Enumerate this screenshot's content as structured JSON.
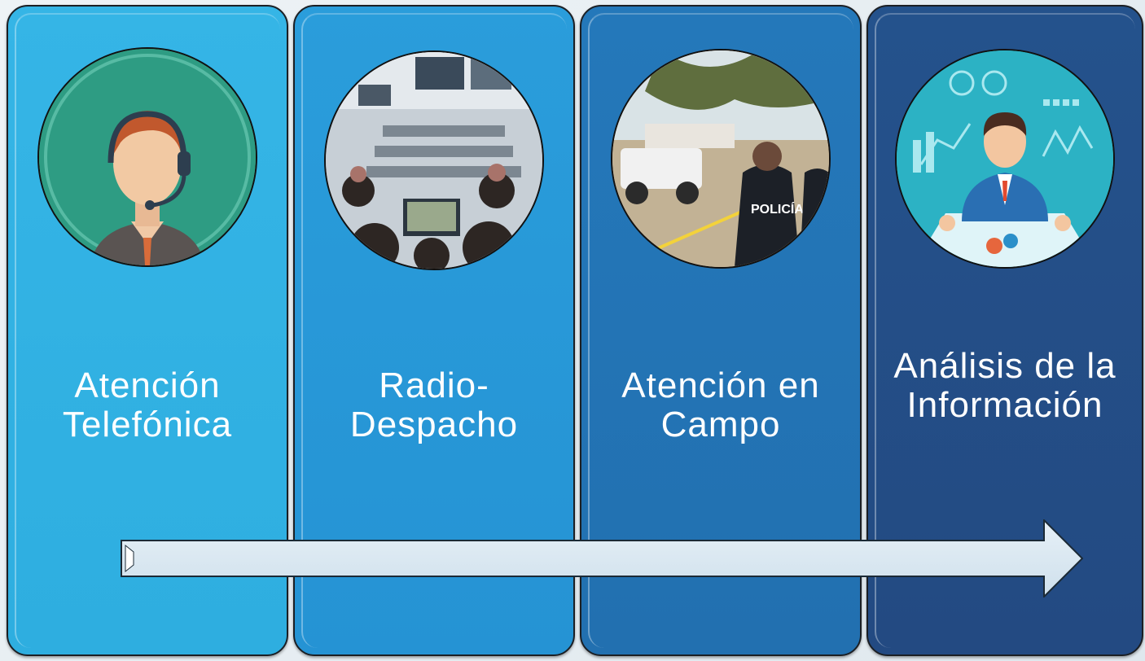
{
  "panels": [
    {
      "label": "Atención Telefónica",
      "color": "#2fb0e2",
      "icon": "call-center-operator-icon"
    },
    {
      "label": "Radio-Despacho",
      "color": "#2795d5",
      "icon": "dispatch-room-photo"
    },
    {
      "label": "Atención en Campo",
      "color": "#2373b3",
      "icon": "municipal-police-photo"
    },
    {
      "label": "Análisis  de la Información",
      "color": "#234f88",
      "icon": "data-analyst-icon"
    }
  ],
  "arrow": {
    "direction": "right",
    "fill": "#dbe9f3"
  }
}
